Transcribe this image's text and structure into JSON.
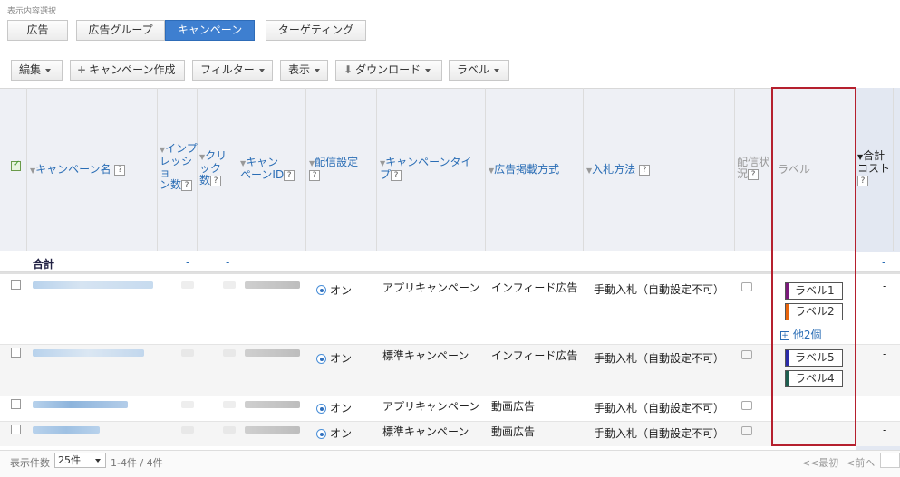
{
  "selector_label": "表示内容選択",
  "tabs": [
    {
      "label": "広告",
      "active": false
    },
    {
      "label": "広告グループ",
      "active": false
    },
    {
      "label": "キャンペーン",
      "active": true
    },
    {
      "label": "ターゲティング",
      "active": false
    }
  ],
  "toolbar": {
    "edit": "編集",
    "create_campaign": "キャンペーン作成",
    "filter": "フィルター",
    "display": "表示",
    "download": "ダウンロード",
    "label": "ラベル"
  },
  "headers": {
    "campaign_name": "キャンペーン名",
    "impressions": [
      "インプ",
      "レッショ",
      "ン数"
    ],
    "clicks": [
      "クリ",
      "ック",
      "数"
    ],
    "campaign_id": [
      "キャン",
      "ペーンID"
    ],
    "delivery_setting": "配信設定",
    "campaign_type": [
      "キャンペーンタイ",
      "プ"
    ],
    "ad_placement": "広告掲載方式",
    "bid_method": "入札方法",
    "delivery_status": [
      "配信状",
      "況"
    ],
    "label": "ラベル",
    "total_cost": [
      "合計",
      "コスト"
    ],
    "help": "?"
  },
  "total_row": {
    "label": "合計",
    "impressions": "-",
    "clicks": "-",
    "cost": "-"
  },
  "rows": [
    {
      "delivery": "オン",
      "type": "アプリキャンペーン",
      "placement": "インフィード広告",
      "bid": "手動入札（自動設定不可）",
      "cost": "-",
      "labels": [
        {
          "text": "ラベル1",
          "color": "#7b1a7b"
        },
        {
          "text": "ラベル2",
          "color": "#e8650e"
        }
      ],
      "more": "他2個"
    },
    {
      "delivery": "オン",
      "type": "標準キャンペーン",
      "placement": "インフィード広告",
      "bid": "手動入札（自動設定不可）",
      "cost": "-",
      "labels": [
        {
          "text": "ラベル5",
          "color": "#2a2aa8"
        },
        {
          "text": "ラベル4",
          "color": "#1d5e4f"
        }
      ],
      "more": ""
    },
    {
      "delivery": "オン",
      "type": "アプリキャンペーン",
      "placement": "動画広告",
      "bid": "手動入札（自動設定不可）",
      "cost": "-",
      "labels": [],
      "more": ""
    },
    {
      "delivery": "オン",
      "type": "標準キャンペーン",
      "placement": "動画広告",
      "bid": "手動入札（自動設定不可）",
      "cost": "-",
      "labels": [],
      "more": ""
    }
  ],
  "pager": {
    "count_label": "表示件数",
    "per_page": "25件",
    "range": "1-4件 / 4件",
    "first": "<<最初",
    "prev": "<前へ"
  }
}
